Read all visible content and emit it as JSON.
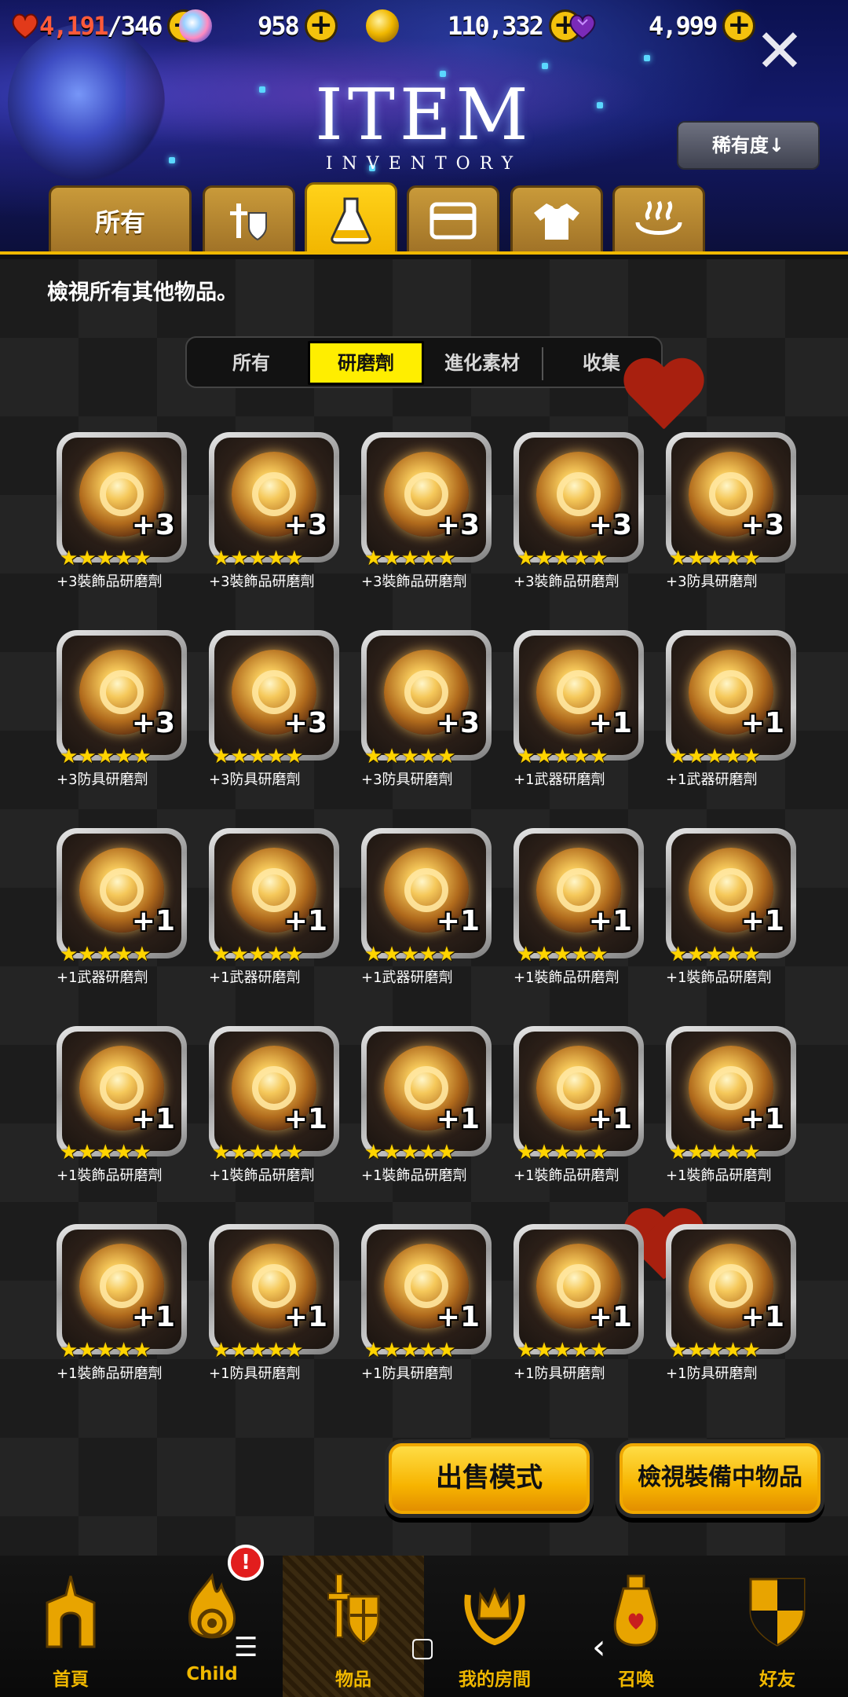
{
  "colors": {
    "accent": "#f0b800",
    "tab_active": "#ffd21a",
    "segment_active": "#ffee00",
    "star": "#ffd400",
    "alert": "#e21d1d"
  },
  "resources": {
    "stamina": {
      "icon": "heart-icon",
      "current": "4,191",
      "max": "/346"
    },
    "crystal": {
      "icon": "crystal-icon",
      "value": "958"
    },
    "gold": {
      "icon": "coin-icon",
      "value": "110,332"
    },
    "gem": {
      "icon": "gem-icon",
      "value": "4,999"
    }
  },
  "header": {
    "title": "ITEM",
    "subtitle": "INVENTORY",
    "sort_label": "稀有度↓",
    "close_glyph": "✕"
  },
  "category_tabs": [
    {
      "label": "所有",
      "icon": ""
    },
    {
      "label": "",
      "icon": "knight-armor-icon"
    },
    {
      "label": "",
      "icon": "flask-icon"
    },
    {
      "label": "",
      "icon": "card-icon"
    },
    {
      "label": "",
      "icon": "shirt-icon"
    },
    {
      "label": "",
      "icon": "hot-spring-icon"
    }
  ],
  "active_category": 2,
  "description": "檢視所有其他物品。",
  "segments": [
    "所有",
    "研磨劑",
    "進化素材",
    "收集"
  ],
  "active_segment": 1,
  "items": [
    {
      "name": "+3裝飾品研磨劑",
      "level": "+3",
      "stars": 5
    },
    {
      "name": "+3裝飾品研磨劑",
      "level": "+3",
      "stars": 5
    },
    {
      "name": "+3裝飾品研磨劑",
      "level": "+3",
      "stars": 5
    },
    {
      "name": "+3裝飾品研磨劑",
      "level": "+3",
      "stars": 5
    },
    {
      "name": "+3防具研磨劑",
      "level": "+3",
      "stars": 5
    },
    {
      "name": "+3防具研磨劑",
      "level": "+3",
      "stars": 5
    },
    {
      "name": "+3防具研磨劑",
      "level": "+3",
      "stars": 5
    },
    {
      "name": "+3防具研磨劑",
      "level": "+3",
      "stars": 5
    },
    {
      "name": "+1武器研磨劑",
      "level": "+1",
      "stars": 5
    },
    {
      "name": "+1武器研磨劑",
      "level": "+1",
      "stars": 5
    },
    {
      "name": "+1武器研磨劑",
      "level": "+1",
      "stars": 5
    },
    {
      "name": "+1武器研磨劑",
      "level": "+1",
      "stars": 5
    },
    {
      "name": "+1武器研磨劑",
      "level": "+1",
      "stars": 5
    },
    {
      "name": "+1裝飾品研磨劑",
      "level": "+1",
      "stars": 5
    },
    {
      "name": "+1裝飾品研磨劑",
      "level": "+1",
      "stars": 5
    },
    {
      "name": "+1裝飾品研磨劑",
      "level": "+1",
      "stars": 5
    },
    {
      "name": "+1裝飾品研磨劑",
      "level": "+1",
      "stars": 5
    },
    {
      "name": "+1裝飾品研磨劑",
      "level": "+1",
      "stars": 5
    },
    {
      "name": "+1裝飾品研磨劑",
      "level": "+1",
      "stars": 5
    },
    {
      "name": "+1裝飾品研磨劑",
      "level": "+1",
      "stars": 5
    },
    {
      "name": "+1裝飾品研磨劑",
      "level": "+1",
      "stars": 5
    },
    {
      "name": "+1防具研磨劑",
      "level": "+1",
      "stars": 5
    },
    {
      "name": "+1防具研磨劑",
      "level": "+1",
      "stars": 5
    },
    {
      "name": "+1防具研磨劑",
      "level": "+1",
      "stars": 5
    },
    {
      "name": "+1防具研磨劑",
      "level": "+1",
      "stars": 5
    }
  ],
  "actions": {
    "sell_mode": "出售模式",
    "view_equipped": "檢視裝備中物品"
  },
  "bottom_nav": [
    {
      "label": "首頁",
      "icon": "home-icon"
    },
    {
      "label": "Child",
      "icon": "child-flame-icon"
    },
    {
      "label": "物品",
      "icon": "sword-shield-icon"
    },
    {
      "label": "我的房間",
      "icon": "crown-laurel-icon"
    },
    {
      "label": "召喚",
      "icon": "summon-potion-icon"
    },
    {
      "label": "好友",
      "icon": "friends-shield-icon"
    }
  ],
  "active_nav": 2,
  "alert_badge": "!",
  "system_nav": {
    "recent": "☰",
    "home": "▢",
    "back": "‹"
  }
}
